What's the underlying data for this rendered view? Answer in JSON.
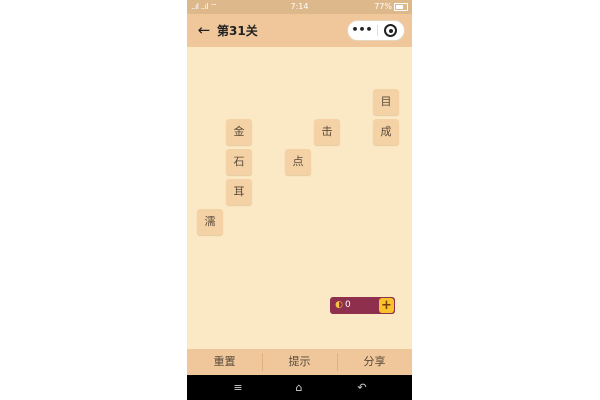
{
  "status_bar": {
    "signal": "..ıl ..ıl ⌔",
    "time": "7:14",
    "battery": "77%"
  },
  "nav": {
    "title": "第31关",
    "back_icon": "back-arrow-icon",
    "more_icon": "more-icon",
    "close_icon": "close-circle-icon"
  },
  "board": {
    "tiles": [
      "目",
      "金",
      "击",
      "成",
      "石",
      "点",
      "耳",
      "濡"
    ]
  },
  "coins": {
    "count": "0",
    "add_label": "+",
    "accent": "#8e2f4e",
    "button_color": "#f7c22a"
  },
  "bottom": {
    "reset_label": "重置",
    "hint_label": "提示",
    "share_label": "分享"
  },
  "android": {
    "menu_icon": "≡",
    "home_icon": "⌂",
    "back_icon": "↶"
  },
  "colors": {
    "board_bg": "#fbe9c5",
    "bar_bg": "#efc79b",
    "tile_bg": "#f5d2a5"
  }
}
